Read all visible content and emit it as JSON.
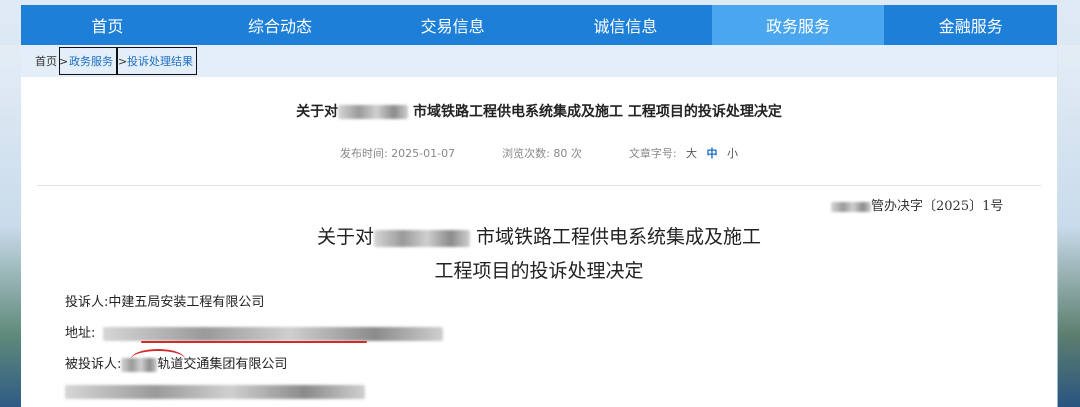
{
  "nav": {
    "items": [
      "首页",
      "综合动态",
      "交易信息",
      "诚信信息",
      "政务服务",
      "金融服务"
    ],
    "active_index": 4,
    "color": "#1d7fd8",
    "active_color": "#4aa6ee"
  },
  "breadcrumb": {
    "home": "首页",
    "sep": ">",
    "items": [
      "政务服务",
      "投诉处理结果"
    ]
  },
  "article": {
    "title_prefix": "关于对",
    "title_suffix": "市域铁路工程供电系统集成及施工 工程项目的投诉处理决定",
    "meta": {
      "publish_label": "发布时间:",
      "publish_date": "2025-01-07",
      "views_label": "浏览次数:",
      "views": "80",
      "views_unit": "次",
      "font_label": "文章字号:",
      "font_options": [
        "大",
        "中",
        "小"
      ],
      "font_active_index": 1
    }
  },
  "document": {
    "number_suffix": "管办决字〔2025〕1号",
    "title_line1_prefix": "关于对",
    "title_line1_suffix": "市域铁路工程供电系统集成及施工",
    "title_line2": "工程项目的投诉处理决定",
    "complainant_label": "投诉人:",
    "complainant": "中建五局安装工程有限公司",
    "address_label": "地址:",
    "respondent_label": "被投诉人:",
    "respondent_suffix": "轨道交通集团有限公司"
  }
}
